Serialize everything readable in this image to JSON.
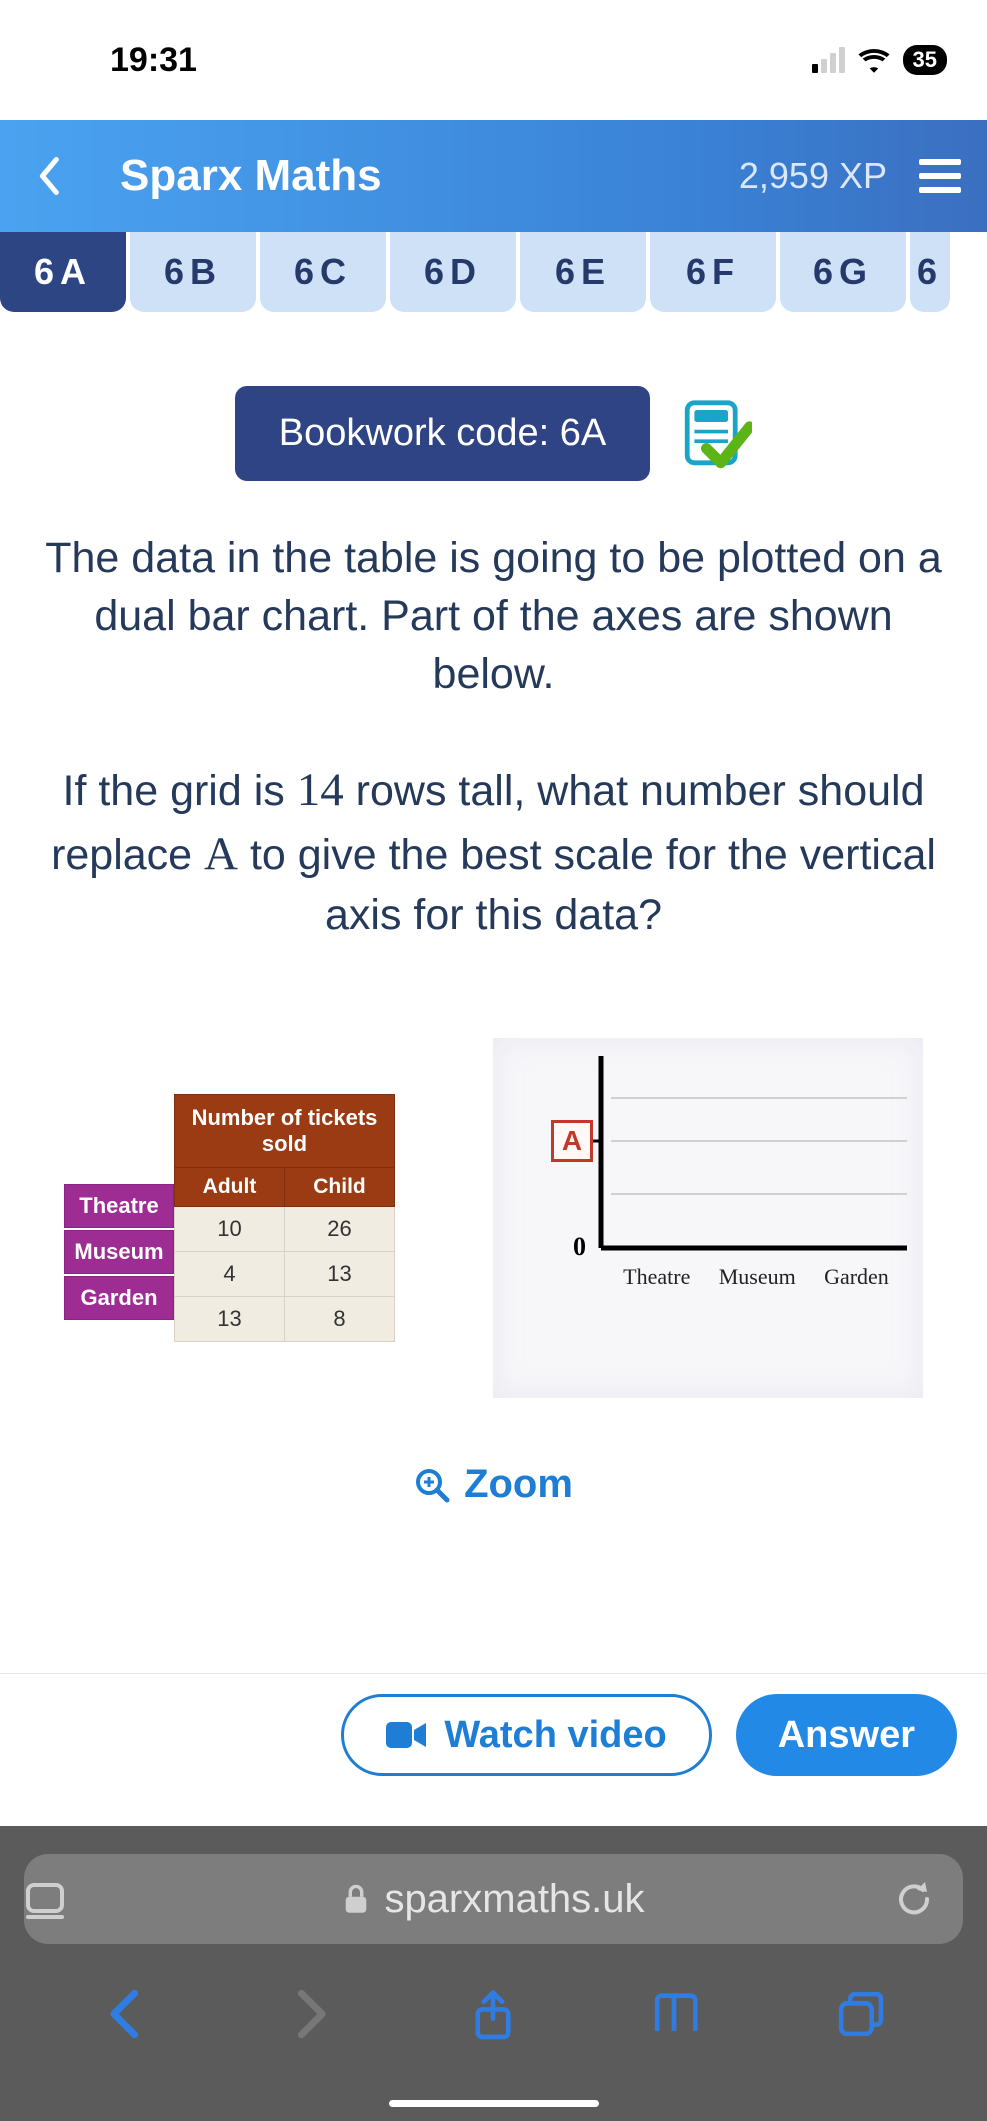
{
  "status": {
    "time": "19:31",
    "battery": "35"
  },
  "header": {
    "title": "Sparx Maths",
    "xp": "2,959 XP"
  },
  "tabs": [
    "6A",
    "6B",
    "6C",
    "6D",
    "6E",
    "6F",
    "6G",
    "6"
  ],
  "active_tab": 0,
  "bookwork": {
    "label": "Bookwork code: 6A"
  },
  "question": {
    "p1a": "The data in the table is going to be plotted on a dual bar chart. Part of the axes are shown below.",
    "p2a": "If the grid is ",
    "p2_n": "14",
    "p2b": " rows tall, what number should replace ",
    "p2_A": "A",
    "p2c": " to give the best scale for the vertical axis for this data?"
  },
  "table": {
    "title": "Number of tickets sold",
    "cols": [
      "Adult",
      "Child"
    ],
    "rows": [
      "Theatre",
      "Museum",
      "Garden"
    ],
    "data": [
      [
        10,
        26
      ],
      [
        4,
        13
      ],
      [
        13,
        8
      ]
    ]
  },
  "axes": {
    "marker": "A",
    "zero": "0",
    "categories": [
      "Theatre",
      "Museum",
      "Garden"
    ]
  },
  "actions": {
    "zoom": "Zoom",
    "watch": "Watch video",
    "answer": "Answer"
  },
  "browser": {
    "url": "sparxmaths.uk"
  },
  "chart_data": {
    "type": "table",
    "title": "Number of tickets sold",
    "categories": [
      "Theatre",
      "Museum",
      "Garden"
    ],
    "series": [
      {
        "name": "Adult",
        "values": [
          10,
          4,
          13
        ]
      },
      {
        "name": "Child",
        "values": [
          26,
          13,
          8
        ]
      }
    ],
    "xlabel": "",
    "ylabel": "",
    "ylim": null,
    "annotations": [
      "grid is 14 rows tall",
      "find value A for vertical axis scale"
    ]
  }
}
